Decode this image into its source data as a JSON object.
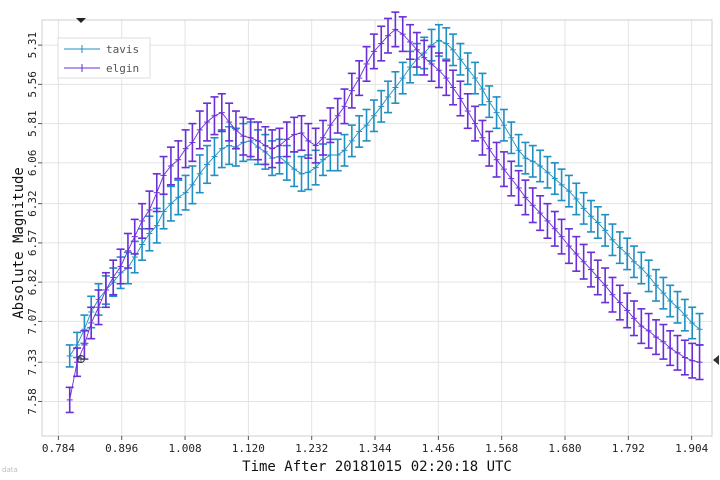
{
  "chart_data": {
    "type": "line",
    "title": "",
    "xlabel": "Time After 20181015 02:20:18 UTC",
    "ylabel": "Absolute Magnitude",
    "xlim": [
      0.755,
      1.94
    ],
    "ylim": [
      7.8,
      5.15
    ],
    "y_inverted": true,
    "x_ticks": [
      "0.784",
      "0.896",
      "1.008",
      "1.120",
      "1.232",
      "1.344",
      "1.456",
      "1.568",
      "1.680",
      "1.792",
      "1.904"
    ],
    "y_ticks": [
      "5.31",
      "5.56",
      "5.81",
      "6.06",
      "6.32",
      "6.57",
      "6.82",
      "7.07",
      "7.33",
      "7.58"
    ],
    "grid": true,
    "legend_position": "top-left",
    "series": [
      {
        "name": "tavis",
        "color": "#1f8fc4",
        "x": [
          0.804,
          0.817,
          0.83,
          0.842,
          0.855,
          0.868,
          0.881,
          0.894,
          0.907,
          0.919,
          0.932,
          0.945,
          0.958,
          0.97,
          0.983,
          0.996,
          1.009,
          1.021,
          1.034,
          1.047,
          1.06,
          1.073,
          1.086,
          1.098,
          1.111,
          1.124,
          1.137,
          1.15,
          1.162,
          1.175,
          1.188,
          1.201,
          1.214,
          1.226,
          1.239,
          1.252,
          1.265,
          1.278,
          1.29,
          1.303,
          1.316,
          1.329,
          1.342,
          1.355,
          1.367,
          1.38,
          1.393,
          1.406,
          1.418,
          1.431,
          1.444,
          1.457,
          1.47,
          1.482,
          1.495,
          1.508,
          1.521,
          1.534,
          1.546,
          1.559,
          1.572,
          1.585,
          1.598,
          1.61,
          1.623,
          1.636,
          1.649,
          1.662,
          1.674,
          1.687,
          1.7,
          1.713,
          1.726,
          1.738,
          1.751,
          1.764,
          1.777,
          1.79,
          1.802,
          1.815,
          1.828,
          1.841,
          1.854,
          1.866,
          1.879,
          1.892,
          1.905,
          1.918
        ],
        "y": [
          7.29,
          7.22,
          7.12,
          7.01,
          6.93,
          6.87,
          6.82,
          6.76,
          6.73,
          6.66,
          6.58,
          6.51,
          6.46,
          6.37,
          6.32,
          6.28,
          6.25,
          6.2,
          6.13,
          6.07,
          6.02,
          5.97,
          5.95,
          5.96,
          5.93,
          5.92,
          5.96,
          5.99,
          6.03,
          6.02,
          6.06,
          6.1,
          6.13,
          6.12,
          6.09,
          6.04,
          6.01,
          6.01,
          5.98,
          5.92,
          5.86,
          5.82,
          5.76,
          5.7,
          5.64,
          5.58,
          5.52,
          5.45,
          5.4,
          5.36,
          5.31,
          5.28,
          5.3,
          5.34,
          5.4,
          5.46,
          5.52,
          5.59,
          5.67,
          5.74,
          5.82,
          5.9,
          5.98,
          6.03,
          6.05,
          6.08,
          6.12,
          6.16,
          6.2,
          6.24,
          6.29,
          6.35,
          6.4,
          6.44,
          6.49,
          6.55,
          6.6,
          6.64,
          6.69,
          6.73,
          6.78,
          6.84,
          6.89,
          6.94,
          6.98,
          7.03,
          7.08,
          7.12
        ],
        "err": [
          0.07,
          0.08,
          0.09,
          0.1,
          0.1,
          0.09,
          0.09,
          0.1,
          0.1,
          0.1,
          0.1,
          0.11,
          0.11,
          0.11,
          0.11,
          0.11,
          0.11,
          0.12,
          0.12,
          0.12,
          0.12,
          0.12,
          0.12,
          0.12,
          0.12,
          0.12,
          0.11,
          0.11,
          0.11,
          0.11,
          0.11,
          0.11,
          0.11,
          0.11,
          0.11,
          0.1,
          0.1,
          0.1,
          0.1,
          0.1,
          0.1,
          0.1,
          0.1,
          0.1,
          0.1,
          0.1,
          0.1,
          0.1,
          0.1,
          0.1,
          0.1,
          0.1,
          0.1,
          0.1,
          0.1,
          0.1,
          0.1,
          0.1,
          0.1,
          0.1,
          0.1,
          0.1,
          0.1,
          0.1,
          0.1,
          0.1,
          0.1,
          0.1,
          0.1,
          0.1,
          0.1,
          0.1,
          0.1,
          0.1,
          0.1,
          0.1,
          0.1,
          0.1,
          0.1,
          0.1,
          0.1,
          0.1,
          0.1,
          0.1,
          0.1,
          0.1,
          0.1,
          0.1
        ]
      },
      {
        "name": "elgin",
        "color": "#6a2fd6",
        "x": [
          0.804,
          0.817,
          0.83,
          0.842,
          0.855,
          0.868,
          0.881,
          0.894,
          0.907,
          0.919,
          0.932,
          0.945,
          0.958,
          0.97,
          0.983,
          0.996,
          1.009,
          1.021,
          1.034,
          1.047,
          1.06,
          1.073,
          1.086,
          1.098,
          1.111,
          1.124,
          1.137,
          1.15,
          1.162,
          1.175,
          1.188,
          1.201,
          1.214,
          1.226,
          1.239,
          1.252,
          1.265,
          1.278,
          1.29,
          1.303,
          1.316,
          1.329,
          1.342,
          1.355,
          1.367,
          1.38,
          1.393,
          1.406,
          1.418,
          1.431,
          1.444,
          1.457,
          1.47,
          1.482,
          1.495,
          1.508,
          1.521,
          1.534,
          1.546,
          1.559,
          1.572,
          1.585,
          1.598,
          1.61,
          1.623,
          1.636,
          1.649,
          1.662,
          1.674,
          1.687,
          1.7,
          1.713,
          1.726,
          1.738,
          1.751,
          1.764,
          1.777,
          1.79,
          1.802,
          1.815,
          1.828,
          1.841,
          1.854,
          1.866,
          1.879,
          1.892,
          1.905,
          1.918
        ],
        "y": [
          7.57,
          7.33,
          7.22,
          7.08,
          6.98,
          6.87,
          6.79,
          6.72,
          6.62,
          6.53,
          6.43,
          6.36,
          6.25,
          6.14,
          6.08,
          6.04,
          5.97,
          5.93,
          5.85,
          5.8,
          5.76,
          5.74,
          5.8,
          5.85,
          5.89,
          5.9,
          5.92,
          5.95,
          5.97,
          5.95,
          5.91,
          5.88,
          5.87,
          5.92,
          5.95,
          5.9,
          5.82,
          5.76,
          5.7,
          5.6,
          5.52,
          5.43,
          5.35,
          5.3,
          5.25,
          5.21,
          5.24,
          5.29,
          5.34,
          5.39,
          5.43,
          5.47,
          5.52,
          5.58,
          5.65,
          5.73,
          5.81,
          5.9,
          5.97,
          6.04,
          6.1,
          6.16,
          6.22,
          6.28,
          6.33,
          6.38,
          6.43,
          6.48,
          6.53,
          6.59,
          6.64,
          6.69,
          6.74,
          6.79,
          6.84,
          6.9,
          6.95,
          7.0,
          7.05,
          7.1,
          7.13,
          7.17,
          7.2,
          7.24,
          7.27,
          7.3,
          7.32,
          7.33
        ],
        "err": [
          0.08,
          0.09,
          0.09,
          0.1,
          0.11,
          0.11,
          0.11,
          0.11,
          0.11,
          0.11,
          0.11,
          0.12,
          0.12,
          0.12,
          0.12,
          0.12,
          0.12,
          0.12,
          0.12,
          0.12,
          0.12,
          0.12,
          0.12,
          0.12,
          0.12,
          0.12,
          0.12,
          0.12,
          0.12,
          0.11,
          0.11,
          0.11,
          0.11,
          0.11,
          0.11,
          0.11,
          0.11,
          0.11,
          0.11,
          0.11,
          0.11,
          0.11,
          0.11,
          0.11,
          0.11,
          0.11,
          0.11,
          0.11,
          0.11,
          0.11,
          0.11,
          0.11,
          0.11,
          0.11,
          0.11,
          0.11,
          0.11,
          0.11,
          0.11,
          0.11,
          0.11,
          0.11,
          0.11,
          0.11,
          0.11,
          0.11,
          0.11,
          0.11,
          0.11,
          0.11,
          0.11,
          0.11,
          0.11,
          0.11,
          0.11,
          0.11,
          0.11,
          0.11,
          0.11,
          0.11,
          0.11,
          0.11,
          0.11,
          0.11,
          0.11,
          0.11,
          0.11,
          0.11
        ]
      }
    ]
  },
  "watermark": "data"
}
